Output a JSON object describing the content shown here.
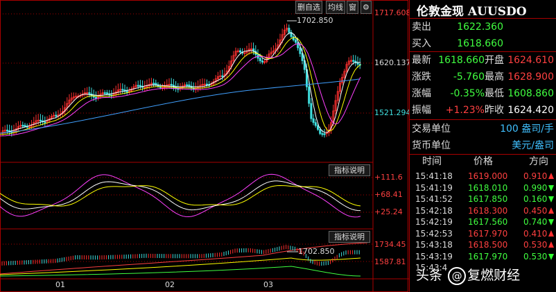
{
  "toolbar": {
    "delete_self_select": "删自选",
    "ma_line": "均线",
    "window": "窗",
    "settings": "⚙"
  },
  "main_chart": {
    "price_axis": [
      "1717.608",
      "1620.137",
      "1521.294"
    ],
    "high_marker": "1702.850",
    "dates": [
      "01",
      "02",
      "03"
    ],
    "colors": {
      "up": "#ff3030",
      "down": "#40e0e0",
      "ma5": "#ffffff",
      "ma10": "#ffff00",
      "ma20": "#ff40ff",
      "ma60": "#40a0ff"
    }
  },
  "indicator1": {
    "button": "指标说明",
    "axis": [
      "+111.6",
      "+68.41",
      "+25.24"
    ]
  },
  "indicator2": {
    "button": "指标说明",
    "axis": [
      "1734.45",
      "1587.81"
    ],
    "high_marker": "1702.850"
  },
  "quote": {
    "title": "伦敦金现 AUUSDO",
    "sell_label": "卖出",
    "sell": "1622.360",
    "buy_label": "买入",
    "buy": "1618.660",
    "latest_label": "最新",
    "latest": "1618.660",
    "open_label": "开盘",
    "open": "1624.610",
    "change_label": "涨跌",
    "change": "-5.760",
    "high_label": "最高",
    "high": "1628.900",
    "pct_label": "涨幅",
    "pct": "-0.35%",
    "low_label": "最低",
    "low": "1608.860",
    "amp_label": "振幅",
    "amp": "+1.23%",
    "prev_label": "昨收",
    "prev": "1624.420",
    "unit_label": "交易单位",
    "unit": "100 盎司/手",
    "currency_label": "货币单位",
    "currency": "美元/盎司",
    "col_time": "时间",
    "col_price": "价格",
    "col_dir": "方向"
  },
  "ticks": [
    {
      "time": "15:41:18",
      "price": "1619.000",
      "qty": "0.910",
      "dir": "up"
    },
    {
      "time": "15:41:19",
      "price": "1618.010",
      "qty": "0.990",
      "dir": "down"
    },
    {
      "time": "15:41:52",
      "price": "1617.850",
      "qty": "0.160",
      "dir": "down"
    },
    {
      "time": "15:42:18",
      "price": "1618.300",
      "qty": "0.450",
      "dir": "up"
    },
    {
      "time": "15:42:19",
      "price": "1617.560",
      "qty": "0.740",
      "dir": "down"
    },
    {
      "time": "15:42:53",
      "price": "1617.970",
      "qty": "0.410",
      "dir": "up"
    },
    {
      "time": "15:43:18",
      "price": "1618.500",
      "qty": "0.530",
      "dir": "up"
    },
    {
      "time": "15:43:19",
      "price": "1617.970",
      "qty": "0.530",
      "dir": "down"
    },
    {
      "time": "15:43:4",
      "price": "",
      "qty": "",
      "dir": ""
    }
  ],
  "watermark": {
    "prefix": "头条",
    "name": "复燃财经"
  }
}
